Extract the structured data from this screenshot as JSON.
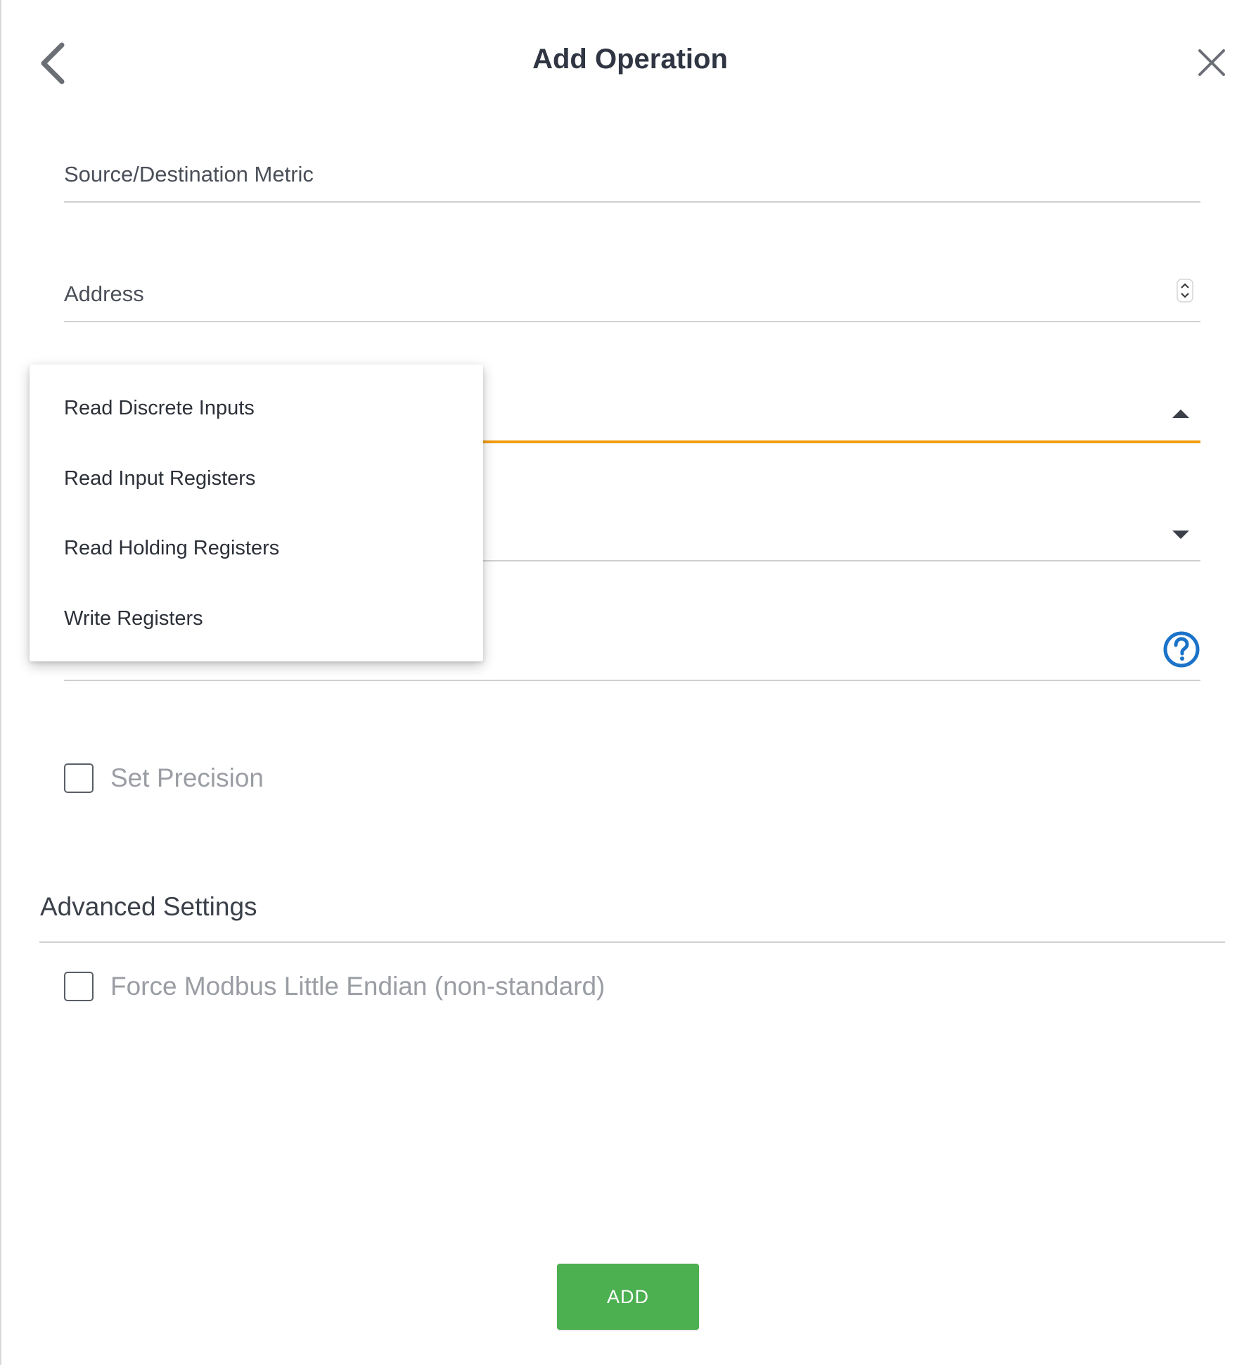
{
  "header": {
    "title": "Add Operation",
    "back_icon": "chevron-left-icon",
    "close_icon": "close-icon"
  },
  "form": {
    "metric_label": "Source/Destination Metric",
    "address_label": "Address",
    "operation_dropdown": {
      "open": true,
      "options": [
        "Read Discrete Inputs",
        "Read Input Registers",
        "Read Holding Registers",
        "Write Registers"
      ]
    },
    "help_icon": "help-circle-icon",
    "set_precision_label": "Set Precision",
    "set_precision_checked": false
  },
  "advanced": {
    "title": "Advanced Settings",
    "little_endian_label": "Force Modbus Little Endian (non-standard)",
    "little_endian_checked": false
  },
  "actions": {
    "add_label": "ADD"
  },
  "colors": {
    "accent_focus": "#f39c12",
    "primary_button": "#4caf50",
    "help_icon": "#1a73c8",
    "title_text": "#2f3542"
  }
}
